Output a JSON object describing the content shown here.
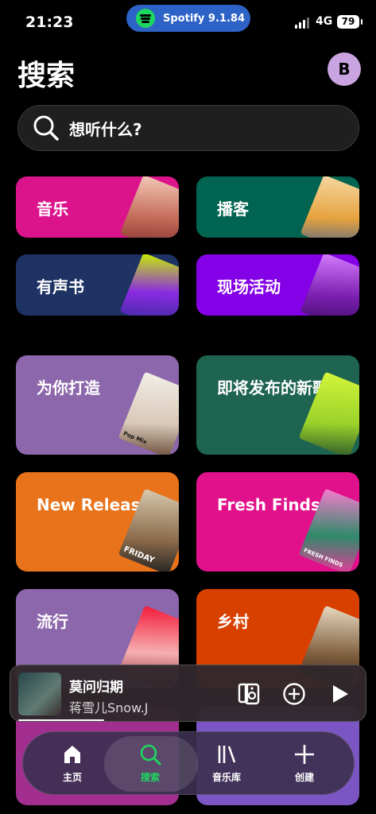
{
  "status": {
    "time": "21:23",
    "network": "4G",
    "battery": "79"
  },
  "island": {
    "label": "Spotify 9.1.84"
  },
  "header": {
    "title": "搜索",
    "avatar_letter": "B"
  },
  "search": {
    "placeholder": "想听什么?"
  },
  "categories": [
    {
      "label": "音乐",
      "color": "#dc148c"
    },
    {
      "label": "播客",
      "color": "#006450"
    },
    {
      "label": "有声书",
      "color": "#1e3264"
    },
    {
      "label": "现场活动",
      "color": "#8400e7"
    },
    {
      "label": "为你打造",
      "color": "#8d67ab"
    },
    {
      "label": "即将发布的新歌",
      "color": "#1e6450"
    },
    {
      "label": "New Releases",
      "color": "#e8731b"
    },
    {
      "label": "Fresh Finds",
      "color": "#e1118c"
    },
    {
      "label": "流行",
      "color": "#8d67ab"
    },
    {
      "label": "乡村",
      "color": "#d84000"
    }
  ],
  "art": {
    "pop_mix": "Pop Mix",
    "fresh_finds": "FRESH FINDS",
    "friday": "FRIDAY"
  },
  "player": {
    "title": "莫问归期",
    "artist": "蒋雪儿Snow.J",
    "progress": 0.24
  },
  "tabs": [
    {
      "label": "主页",
      "icon": "home-icon"
    },
    {
      "label": "搜索",
      "icon": "search-icon"
    },
    {
      "label": "音乐库",
      "icon": "library-icon"
    },
    {
      "label": "创建",
      "icon": "plus-icon"
    }
  ],
  "colors": {
    "accent": "#1ed760",
    "island": "#2d62c6",
    "avatar": "#c9a4e0"
  }
}
